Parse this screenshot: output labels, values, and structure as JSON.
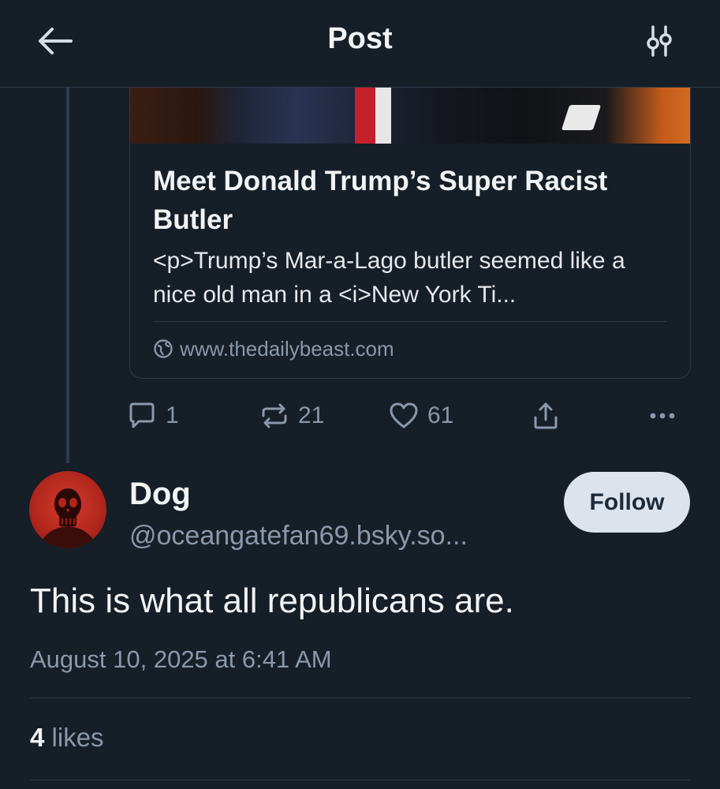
{
  "header": {
    "title": "Post",
    "back_icon": "arrow-left-icon",
    "settings_icon": "sliders-icon"
  },
  "link_card": {
    "title": "Meet Donald Trump’s Super Racist Butler",
    "description": "<p>Trump’s Mar-a-Lago butler seemed like a nice old man in a <i>New York Ti...",
    "domain": "www.thedailybeast.com",
    "domain_icon": "globe-icon"
  },
  "actions": {
    "reply_count": "1",
    "repost_count": "21",
    "like_count": "61",
    "reply_icon": "comment-icon",
    "repost_icon": "repost-icon",
    "like_icon": "heart-icon",
    "share_icon": "share-icon",
    "more_icon": "more-horizontal-icon"
  },
  "author": {
    "name": "Dog",
    "handle": "@oceangatefan69.bsky.so...",
    "follow_label": "Follow"
  },
  "post": {
    "text": "This is what all republicans are.",
    "timestamp": "August 10, 2025 at 6:41 AM",
    "likes_count": "4",
    "likes_label": " likes"
  },
  "colors": {
    "background": "#161e27",
    "border": "#2e3b4a",
    "muted_text": "#8a98aa",
    "primary_text": "#f1f3f5",
    "follow_button_bg": "#dce3ec"
  }
}
